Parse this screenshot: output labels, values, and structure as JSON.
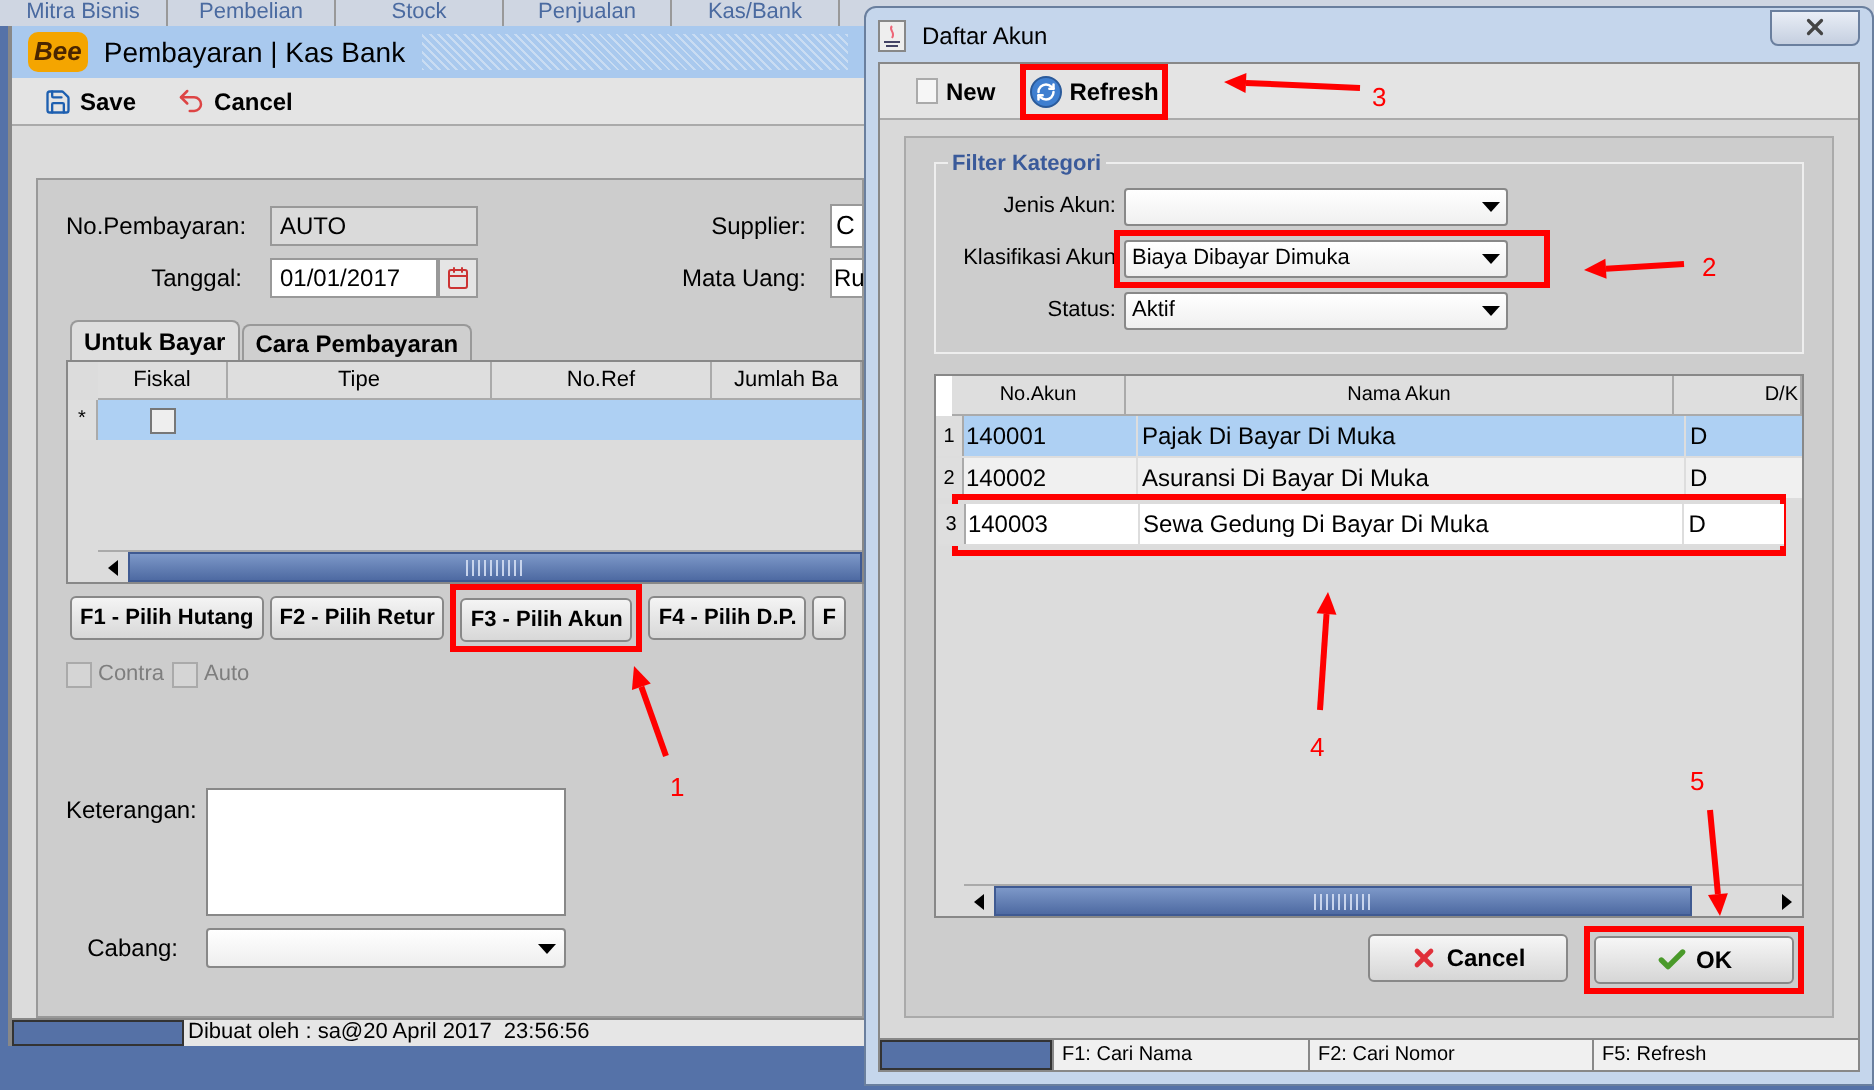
{
  "menu_tabs": [
    "Mitra Bisnis",
    "Pembelian",
    "Stock",
    "Penjualan",
    "Kas/Bank"
  ],
  "main_window": {
    "logo": "Bee",
    "title": "Pembayaran | Kas Bank",
    "toolbar": [
      {
        "kind": "save",
        "label": "Save"
      },
      {
        "kind": "cancel",
        "label": "Cancel"
      }
    ],
    "fields": {
      "no_pembayaran": {
        "label": "No.Pembayaran:",
        "value": "AUTO"
      },
      "tanggal": {
        "label": "Tanggal:",
        "value": "01/01/2017"
      },
      "supplier": {
        "label": "Supplier:",
        "value": "C"
      },
      "mata_uang": {
        "label": "Mata Uang:",
        "value": "Ru"
      }
    },
    "tabs": [
      {
        "label": "Untuk Bayar",
        "selected": true
      },
      {
        "label": "Cara Pembayaran",
        "selected": false
      }
    ],
    "table": {
      "columns": [
        "Fiskal",
        "Tipe",
        "No.Ref",
        "Jumlah Ba"
      ],
      "rows": [
        {
          "marker": "*",
          "fiskal": false,
          "selected": true
        }
      ]
    },
    "buttons": [
      {
        "label": "F1 - Pilih Hutang",
        "highlighted": false
      },
      {
        "label": "F2 - Pilih Retur",
        "highlighted": false
      },
      {
        "label": "F3 - Pilih Akun",
        "highlighted": true
      },
      {
        "label": "F4 - Pilih D.P.",
        "highlighted": false
      },
      {
        "label": "F",
        "highlighted": false
      }
    ],
    "options": [
      {
        "label": "Contra",
        "checked": false,
        "disabled": true
      },
      {
        "label": "Auto",
        "checked": false,
        "disabled": true
      }
    ],
    "keterangan": {
      "label": "Keterangan:"
    },
    "cabang": {
      "label": "Cabang:"
    },
    "status_bar": "Dibuat oleh : sa@20 April 2017  23:56:56"
  },
  "dialog": {
    "title": "Daftar Akun",
    "toolbar": [
      {
        "kind": "new",
        "label": "New",
        "highlighted": false
      },
      {
        "kind": "refresh",
        "label": "Refresh",
        "highlighted": true
      }
    ],
    "filter": {
      "title": "Filter Kategori",
      "fields": [
        {
          "label": "Jenis Akun:",
          "highlighted": false
        },
        {
          "label": "Klasifikasi Akun",
          "value": "Biaya Dibayar Dimuka",
          "highlighted": true
        },
        {
          "label": "Status:",
          "value": "Aktif",
          "highlighted": false
        }
      ]
    },
    "table": {
      "columns": [
        "No.Akun",
        "Nama Akun",
        "D/K"
      ],
      "rows": [
        {
          "index": "1",
          "no": "140001",
          "nama": "Pajak Di Bayar Di Muka",
          "dk": "D",
          "selected": true,
          "highlighted": false
        },
        {
          "index": "2",
          "no": "140002",
          "nama": "Asuransi Di Bayar Di Muka",
          "dk": "D",
          "selected": false,
          "highlighted": false
        },
        {
          "index": "3",
          "no": "140003",
          "nama": "Sewa Gedung Di Bayar Di Muka",
          "dk": "D",
          "selected": false,
          "highlighted": true
        }
      ]
    },
    "buttons": [
      {
        "kind": "cancel",
        "label": "Cancel",
        "highlighted": false
      },
      {
        "kind": "ok",
        "label": "OK",
        "highlighted": true
      }
    ],
    "status_bar": [
      "F1: Cari Nama",
      "F2: Cari Nomor",
      "F5: Refresh"
    ]
  },
  "annotations": [
    {
      "label": "1"
    },
    {
      "label": "2"
    },
    {
      "label": "3"
    },
    {
      "label": "4"
    },
    {
      "label": "5"
    }
  ]
}
